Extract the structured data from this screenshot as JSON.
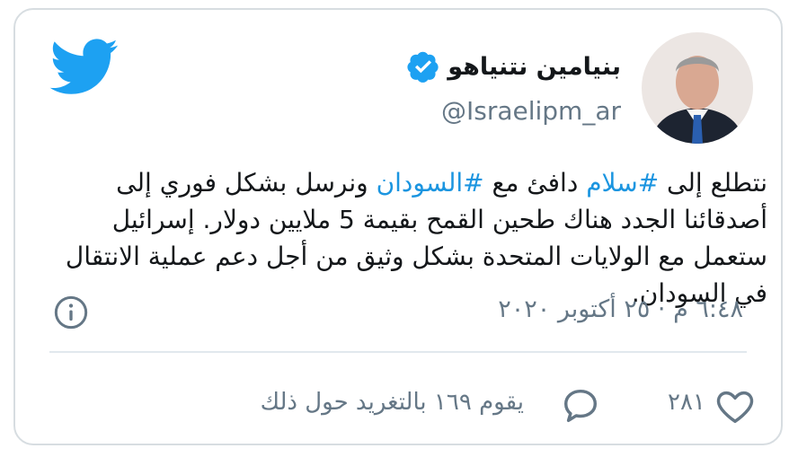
{
  "tweet": {
    "display_name": "بنيامين نتنياهو",
    "handle": "@Israelipm_ar",
    "text": {
      "p1": "نتطلع إلى ",
      "h1": "#سلام",
      "p2": " دافئ مع ",
      "h2": "#السودان",
      "p3": " ونرسل بشكل فوري إلى أصدقائنا الجدد هناك طحين القمح بقيمة 5 ملايين دولار. إسرائيل ستعمل مع الولايات المتحدة بشكل وثيق من أجل دعم عملية الانتقال في السودان."
    },
    "timestamp": "٦:٤٨ م · ٢٥ أكتوبر ٢٠٢٠",
    "like_count": "٢٨١",
    "reply_label": "يقوم ١٦٩ بالتغريد حول ذلك"
  },
  "colors": {
    "brand_blue": "#1da1f2",
    "hashtag_blue": "#1b95e0",
    "secondary_text": "#657786",
    "border": "#d7dde1"
  },
  "icons": {
    "logo": "twitter-bird-icon",
    "verified": "verified-badge-icon",
    "info": "info-icon",
    "like": "heart-icon",
    "reply": "speech-bubble-icon"
  }
}
